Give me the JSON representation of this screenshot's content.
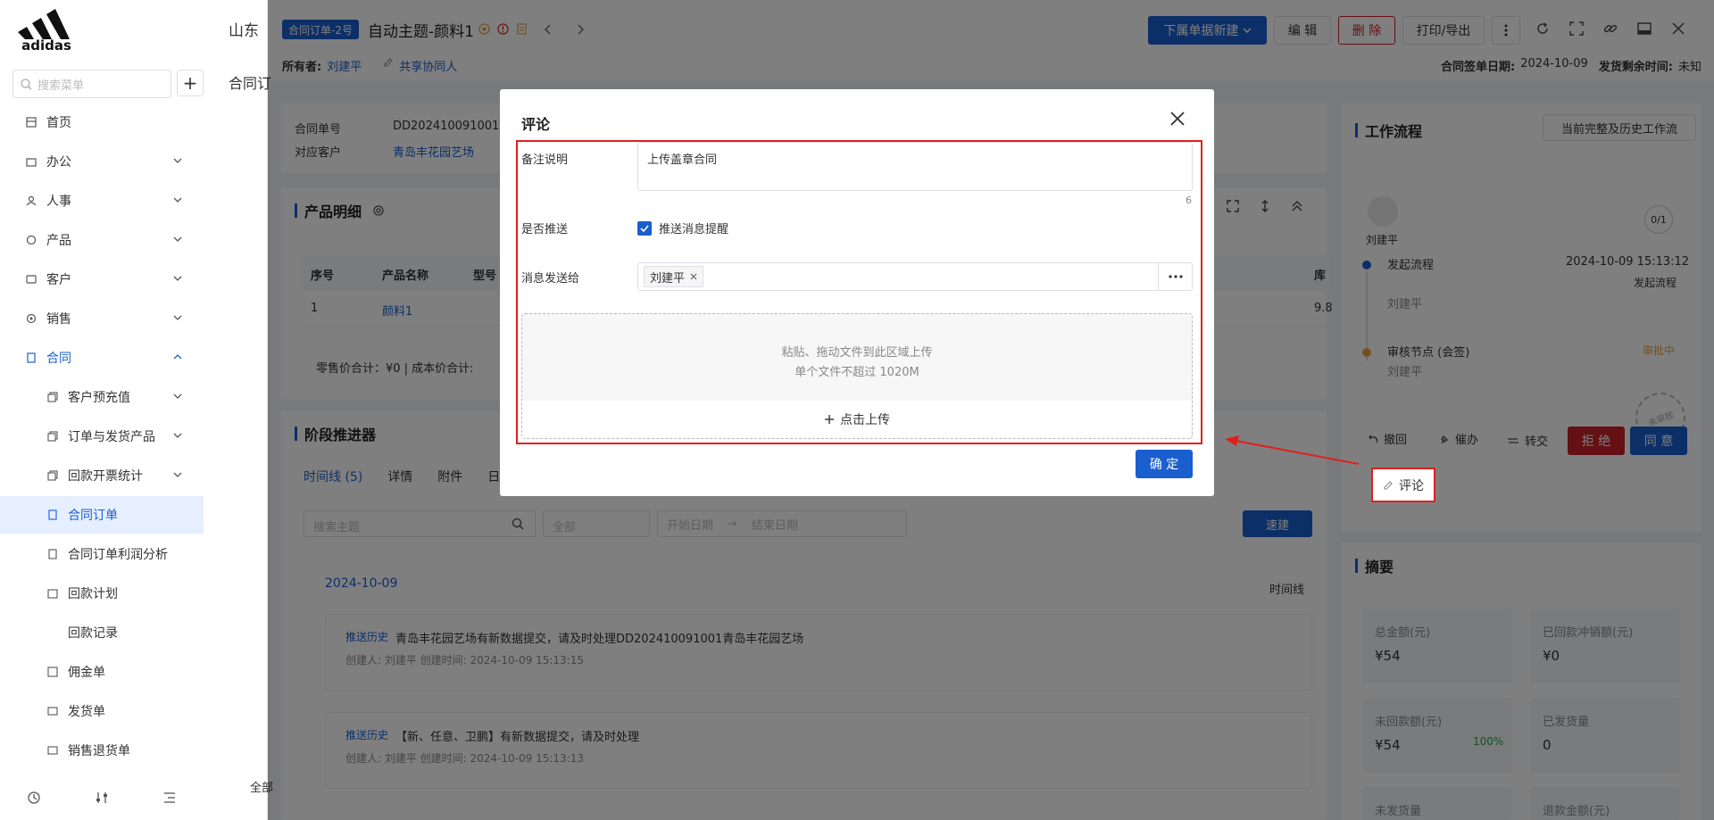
{
  "sidebar": {
    "search_placeholder": "搜索菜单",
    "items": [
      {
        "label": "首页"
      },
      {
        "label": "办公"
      },
      {
        "label": "人事"
      },
      {
        "label": "产品"
      },
      {
        "label": "客户"
      },
      {
        "label": "销售"
      },
      {
        "label": "合同"
      },
      {
        "label": "客户预充值"
      },
      {
        "label": "订单与发货产品"
      },
      {
        "label": "回款开票统计"
      },
      {
        "label": "合同订单"
      },
      {
        "label": "合同订单利润分析"
      },
      {
        "label": "回款计划"
      },
      {
        "label": "回款记录"
      },
      {
        "label": "佣金单"
      },
      {
        "label": "发货单"
      },
      {
        "label": "销售退货单"
      }
    ]
  },
  "header": {
    "company": "山东",
    "badge": "合同订单-2号",
    "title": "自动主题-颜料1",
    "owner_label": "所有者:",
    "owner": "刘建平",
    "share": "共享协同人",
    "buttons": {
      "new_sub": "下属单据新建",
      "edit": "编 辑",
      "delete": "删 除",
      "print": "打印/导出"
    },
    "sign_date_label": "合同签单日期:",
    "sign_date": "2024-10-09",
    "remain_label": "发货剩余时间:",
    "remain": "未知",
    "breadcrumb": "合同订"
  },
  "colors": {
    "primary": "#1a5ecf",
    "danger": "#c8202a",
    "highlight": "#e02020"
  },
  "info": {
    "no_label": "合同单号",
    "no": "DD202410091001",
    "customer_label": "对应客户",
    "customer": "青岛丰花园艺场"
  },
  "products": {
    "title": "产品明细",
    "headers": [
      "序号",
      "产品名称",
      "型号",
      "库"
    ],
    "row": {
      "idx": "1",
      "name": "颜料1",
      "stock": "9.8"
    },
    "footer": "零售价合计：¥0 |   成本价合计:"
  },
  "stage": {
    "title": "阶段推进器",
    "tabs": [
      "时间线 (5)",
      "详情",
      "附件",
      "日"
    ],
    "search_placeholder": "搜索主题",
    "filter_all": "全部",
    "start_date": "开始日期",
    "end_date": "结束日期",
    "quick": "速建",
    "date": "2024-10-09",
    "timeline_label": "时间线",
    "entries": [
      {
        "tag": "推送历史",
        "text": "青岛丰花园艺场有新数据提交，请及时处理DD202410091001青岛丰花园艺场",
        "meta": "创建人: 刘建平   创建时间: 2024-10-09 15:13:15"
      },
      {
        "tag": "推送历史",
        "text": "【新、任意、卫鹏】有新数据提交，请及时处理",
        "meta": "创建人: 刘建平   创建时间: 2024-10-09 15:13:13"
      }
    ],
    "bottom_left": "全部"
  },
  "workflow": {
    "title": "工作流程",
    "history_btn": "当前完整及历史工作流",
    "user": "刘建平",
    "count": "0/1",
    "step1": {
      "name": "发起流程",
      "time": "2024-10-09 15:13:12",
      "status": "发起流程",
      "user": "刘建平"
    },
    "step2": {
      "name": "审核节点 (会签)",
      "status": "审批中",
      "user": "刘建平"
    },
    "stamp": "未审核",
    "actions": {
      "withdraw": "撤回",
      "urge": "催办",
      "transfer": "转交",
      "reject": "拒 绝",
      "approve": "同 意"
    },
    "comment": "评论"
  },
  "summary": {
    "title": "摘要",
    "cards": [
      {
        "label": "总金额(元)",
        "value": "¥54"
      },
      {
        "label": "已回款冲销额(元)",
        "value": "¥0"
      },
      {
        "label": "未回款额(元)",
        "value": "¥54",
        "pct": "100%"
      },
      {
        "label": "已发货量",
        "value": "0"
      },
      {
        "label": "未发货量",
        "value": ""
      },
      {
        "label": "退款金额(元)",
        "value": ""
      }
    ]
  },
  "modal": {
    "title": "评论",
    "remark_label": "备注说明",
    "remark_value": "上传盖章合同",
    "char_count": "6",
    "push_label": "是否推送",
    "push_option": "推送消息提醒",
    "push_checked": true,
    "send_to_label": "消息发送给",
    "recipient": "刘建平",
    "drop_line1": "粘贴、拖动文件到此区域上传",
    "drop_line2": "单个文件不超过 1020M",
    "upload_btn": "点击上传",
    "confirm": "确 定"
  }
}
